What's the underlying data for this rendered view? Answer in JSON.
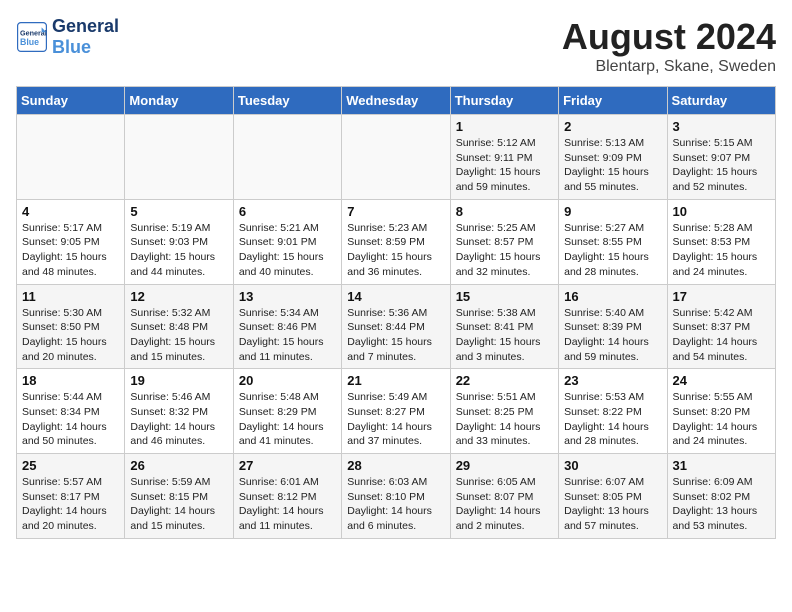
{
  "header": {
    "logo_general": "General",
    "logo_blue": "Blue",
    "month_year": "August 2024",
    "location": "Blentarp, Skane, Sweden"
  },
  "weekdays": [
    "Sunday",
    "Monday",
    "Tuesday",
    "Wednesday",
    "Thursday",
    "Friday",
    "Saturday"
  ],
  "weeks": [
    [
      {
        "day": "",
        "info": ""
      },
      {
        "day": "",
        "info": ""
      },
      {
        "day": "",
        "info": ""
      },
      {
        "day": "",
        "info": ""
      },
      {
        "day": "1",
        "info": "Sunrise: 5:12 AM\nSunset: 9:11 PM\nDaylight: 15 hours\nand 59 minutes."
      },
      {
        "day": "2",
        "info": "Sunrise: 5:13 AM\nSunset: 9:09 PM\nDaylight: 15 hours\nand 55 minutes."
      },
      {
        "day": "3",
        "info": "Sunrise: 5:15 AM\nSunset: 9:07 PM\nDaylight: 15 hours\nand 52 minutes."
      }
    ],
    [
      {
        "day": "4",
        "info": "Sunrise: 5:17 AM\nSunset: 9:05 PM\nDaylight: 15 hours\nand 48 minutes."
      },
      {
        "day": "5",
        "info": "Sunrise: 5:19 AM\nSunset: 9:03 PM\nDaylight: 15 hours\nand 44 minutes."
      },
      {
        "day": "6",
        "info": "Sunrise: 5:21 AM\nSunset: 9:01 PM\nDaylight: 15 hours\nand 40 minutes."
      },
      {
        "day": "7",
        "info": "Sunrise: 5:23 AM\nSunset: 8:59 PM\nDaylight: 15 hours\nand 36 minutes."
      },
      {
        "day": "8",
        "info": "Sunrise: 5:25 AM\nSunset: 8:57 PM\nDaylight: 15 hours\nand 32 minutes."
      },
      {
        "day": "9",
        "info": "Sunrise: 5:27 AM\nSunset: 8:55 PM\nDaylight: 15 hours\nand 28 minutes."
      },
      {
        "day": "10",
        "info": "Sunrise: 5:28 AM\nSunset: 8:53 PM\nDaylight: 15 hours\nand 24 minutes."
      }
    ],
    [
      {
        "day": "11",
        "info": "Sunrise: 5:30 AM\nSunset: 8:50 PM\nDaylight: 15 hours\nand 20 minutes."
      },
      {
        "day": "12",
        "info": "Sunrise: 5:32 AM\nSunset: 8:48 PM\nDaylight: 15 hours\nand 15 minutes."
      },
      {
        "day": "13",
        "info": "Sunrise: 5:34 AM\nSunset: 8:46 PM\nDaylight: 15 hours\nand 11 minutes."
      },
      {
        "day": "14",
        "info": "Sunrise: 5:36 AM\nSunset: 8:44 PM\nDaylight: 15 hours\nand 7 minutes."
      },
      {
        "day": "15",
        "info": "Sunrise: 5:38 AM\nSunset: 8:41 PM\nDaylight: 15 hours\nand 3 minutes."
      },
      {
        "day": "16",
        "info": "Sunrise: 5:40 AM\nSunset: 8:39 PM\nDaylight: 14 hours\nand 59 minutes."
      },
      {
        "day": "17",
        "info": "Sunrise: 5:42 AM\nSunset: 8:37 PM\nDaylight: 14 hours\nand 54 minutes."
      }
    ],
    [
      {
        "day": "18",
        "info": "Sunrise: 5:44 AM\nSunset: 8:34 PM\nDaylight: 14 hours\nand 50 minutes."
      },
      {
        "day": "19",
        "info": "Sunrise: 5:46 AM\nSunset: 8:32 PM\nDaylight: 14 hours\nand 46 minutes."
      },
      {
        "day": "20",
        "info": "Sunrise: 5:48 AM\nSunset: 8:29 PM\nDaylight: 14 hours\nand 41 minutes."
      },
      {
        "day": "21",
        "info": "Sunrise: 5:49 AM\nSunset: 8:27 PM\nDaylight: 14 hours\nand 37 minutes."
      },
      {
        "day": "22",
        "info": "Sunrise: 5:51 AM\nSunset: 8:25 PM\nDaylight: 14 hours\nand 33 minutes."
      },
      {
        "day": "23",
        "info": "Sunrise: 5:53 AM\nSunset: 8:22 PM\nDaylight: 14 hours\nand 28 minutes."
      },
      {
        "day": "24",
        "info": "Sunrise: 5:55 AM\nSunset: 8:20 PM\nDaylight: 14 hours\nand 24 minutes."
      }
    ],
    [
      {
        "day": "25",
        "info": "Sunrise: 5:57 AM\nSunset: 8:17 PM\nDaylight: 14 hours\nand 20 minutes."
      },
      {
        "day": "26",
        "info": "Sunrise: 5:59 AM\nSunset: 8:15 PM\nDaylight: 14 hours\nand 15 minutes."
      },
      {
        "day": "27",
        "info": "Sunrise: 6:01 AM\nSunset: 8:12 PM\nDaylight: 14 hours\nand 11 minutes."
      },
      {
        "day": "28",
        "info": "Sunrise: 6:03 AM\nSunset: 8:10 PM\nDaylight: 14 hours\nand 6 minutes."
      },
      {
        "day": "29",
        "info": "Sunrise: 6:05 AM\nSunset: 8:07 PM\nDaylight: 14 hours\nand 2 minutes."
      },
      {
        "day": "30",
        "info": "Sunrise: 6:07 AM\nSunset: 8:05 PM\nDaylight: 13 hours\nand 57 minutes."
      },
      {
        "day": "31",
        "info": "Sunrise: 6:09 AM\nSunset: 8:02 PM\nDaylight: 13 hours\nand 53 minutes."
      }
    ]
  ]
}
